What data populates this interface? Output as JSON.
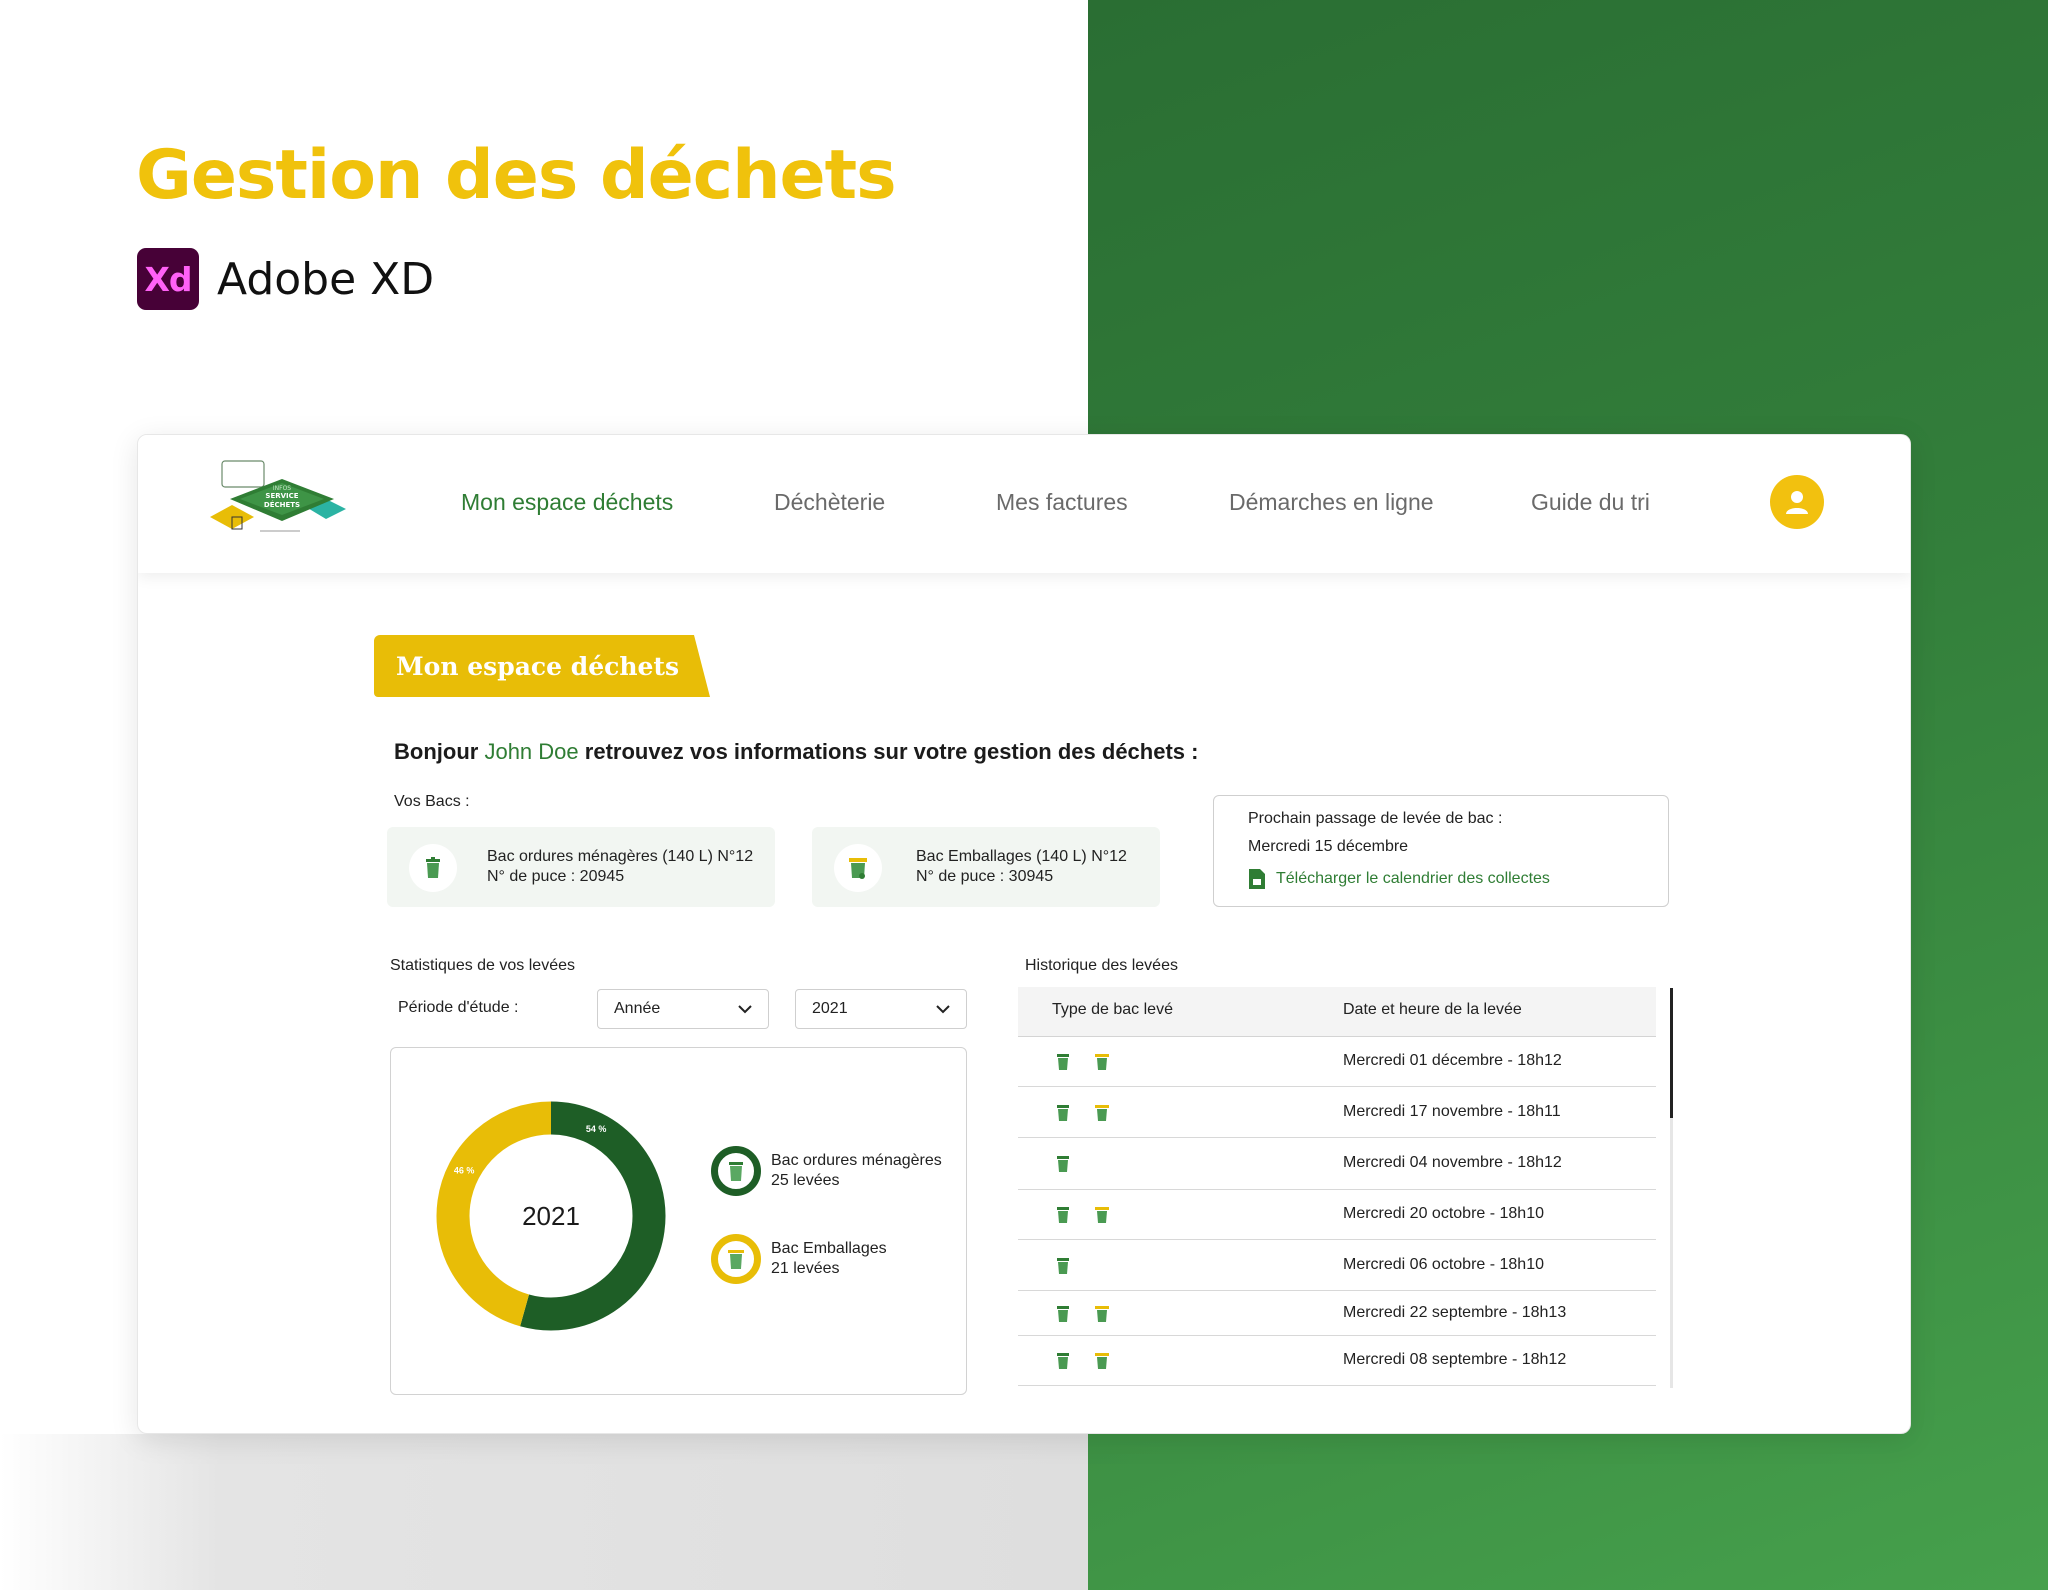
{
  "hero": {
    "title": "Gestion des déchets",
    "tool_logo": "Xd",
    "tool_name": "Adobe XD"
  },
  "nav": {
    "items": [
      {
        "label": "Mon espace déchets",
        "active": true
      },
      {
        "label": "Déchèterie",
        "active": false
      },
      {
        "label": "Mes factures",
        "active": false
      },
      {
        "label": "Démarches en ligne",
        "active": false
      },
      {
        "label": "Guide du tri",
        "active": false
      }
    ],
    "user_icon": "user-icon"
  },
  "page": {
    "tab_title": "Mon espace déchets",
    "greeting_prefix": "Bonjour",
    "user_name": "John Doe",
    "greeting_suffix": "retrouvez vos informations sur votre gestion des déchets :"
  },
  "bins": {
    "label": "Vos Bacs :",
    "items": [
      {
        "title": "Bac ordures ménagères (140 L) N°12",
        "chip": "N° de puce : 20945",
        "icon": "green-bin-icon"
      },
      {
        "title": "Bac Emballages (140 L) N°12",
        "chip": "N° de puce : 30945",
        "icon": "yellow-bin-icon"
      }
    ]
  },
  "next_pickup": {
    "label": "Prochain passage de levée de bac :",
    "date": "Mercredi 15 décembre",
    "download_label": "Télécharger le calendrier des collectes",
    "download_icon": "document-icon"
  },
  "stats": {
    "title": "Statistiques de vos levées",
    "period_label": "Période d'étude :",
    "period_select": "Année",
    "year_select": "2021"
  },
  "chart_data": {
    "type": "pie",
    "center_label": "2021",
    "series": [
      {
        "name": "Bac ordures ménagères",
        "value": 25,
        "value_label": "25 levées",
        "percent_label": "54 %",
        "color": "#1e5e26"
      },
      {
        "name": "Bac Emballages",
        "value": 21,
        "value_label": "21 levées",
        "percent_label": "46 %",
        "color": "#e8bd07"
      }
    ]
  },
  "history": {
    "title": "Historique des levées",
    "columns": [
      "Type de bac levé",
      "Date et heure de la levée"
    ],
    "rows": [
      {
        "bins": [
          "green",
          "yellow"
        ],
        "date": "Mercredi 01 décembre - 18h12"
      },
      {
        "bins": [
          "green",
          "yellow"
        ],
        "date": "Mercredi 17 novembre - 18h11"
      },
      {
        "bins": [
          "green"
        ],
        "date": "Mercredi 04 novembre - 18h12"
      },
      {
        "bins": [
          "green",
          "yellow"
        ],
        "date": "Mercredi 20 octobre - 18h10"
      },
      {
        "bins": [
          "green"
        ],
        "date": "Mercredi 06 octobre - 18h10"
      },
      {
        "bins": [
          "green",
          "yellow"
        ],
        "date": "Mercredi 22 septembre - 18h13"
      },
      {
        "bins": [
          "green",
          "yellow"
        ],
        "date": "Mercredi 08 septembre - 18h12"
      }
    ]
  },
  "colors": {
    "brand_green": "#2f7d34",
    "brand_yellow": "#e8bd07",
    "dark_green": "#1e5e26"
  }
}
